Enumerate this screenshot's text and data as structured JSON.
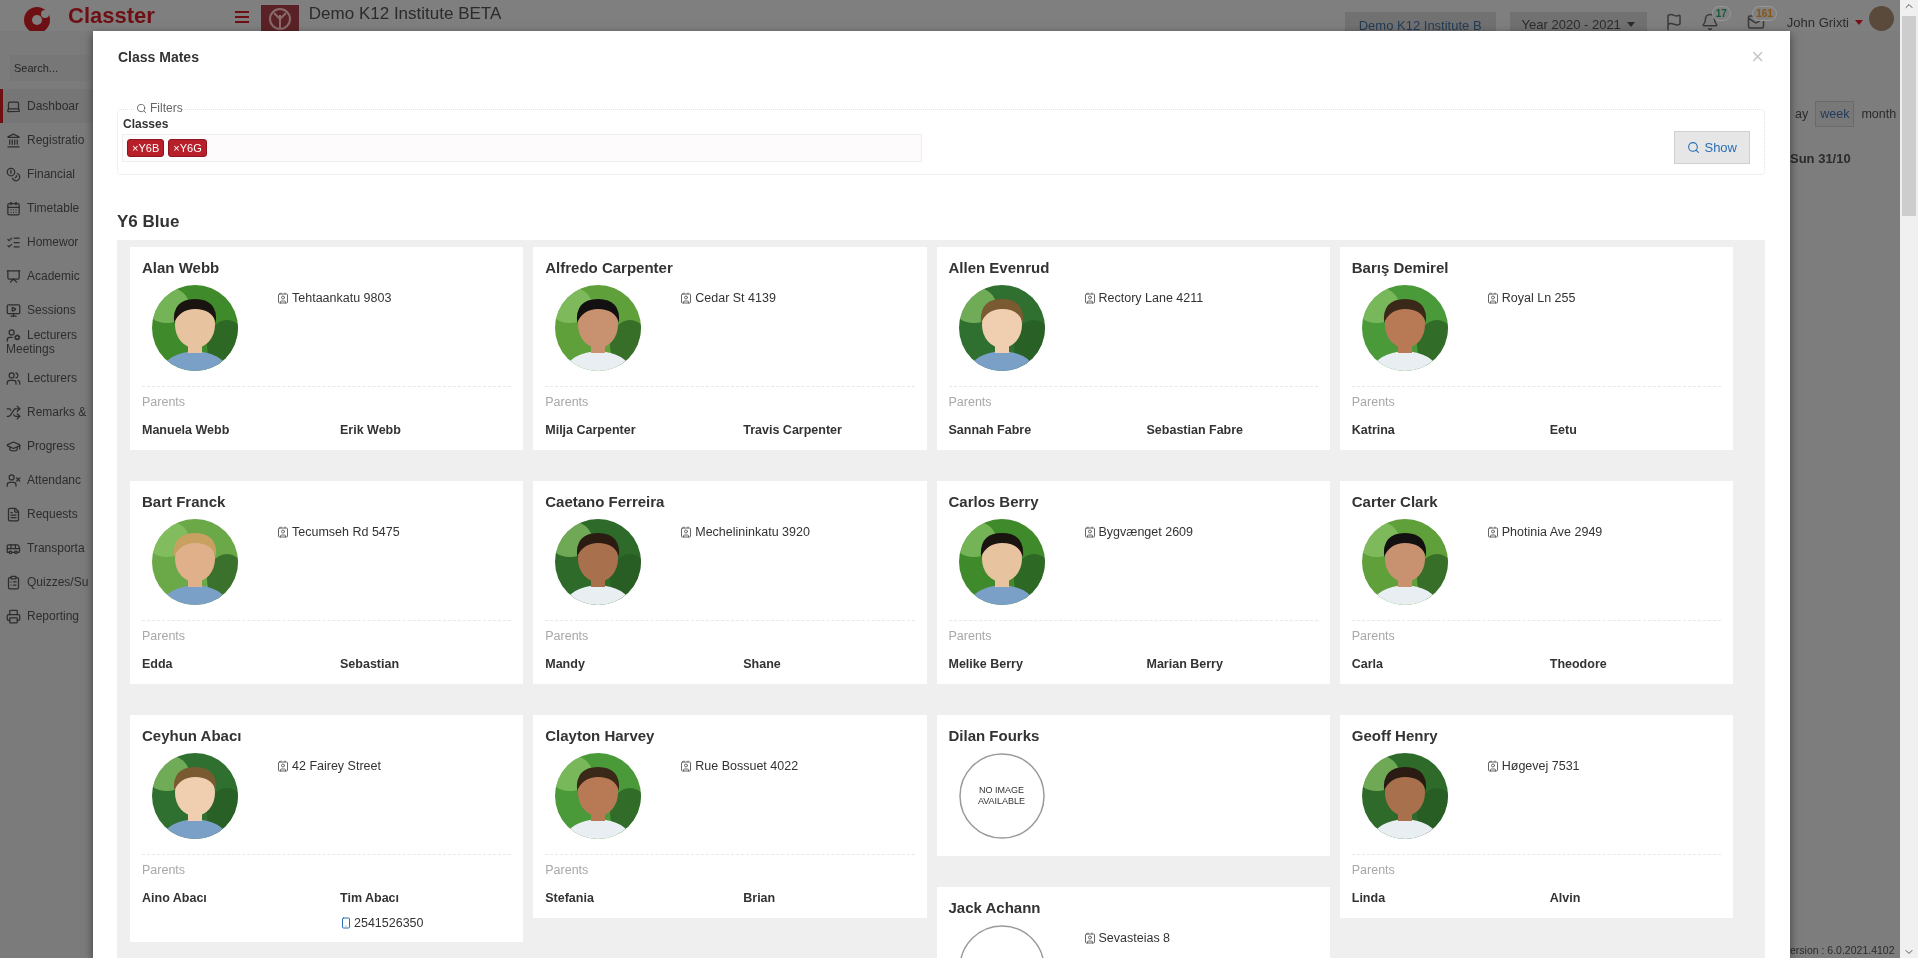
{
  "header": {
    "brand": "Classter",
    "institute": "Demo K12 Institute BETA",
    "institute_button": "Demo K12 Institute B",
    "year": "Year 2020 - 2021",
    "notifications": "17",
    "messages": "161",
    "user": "John Grixti"
  },
  "sidebar": {
    "search_placeholder": "Search...",
    "items": [
      {
        "label": "Dashboar",
        "selected": true
      },
      {
        "label": "Registratio",
        "selected": false
      },
      {
        "label": "Financial",
        "selected": false
      },
      {
        "label": "Timetable",
        "selected": false
      },
      {
        "label": "Homewor",
        "selected": false
      },
      {
        "label": "Academic",
        "selected": false
      },
      {
        "label": "Sessions",
        "selected": false
      },
      {
        "label": "Lecturers",
        "continuation": "Meetings",
        "selected": false
      },
      {
        "label": "Lecturers",
        "selected": false
      },
      {
        "label": "Remarks &",
        "selected": false
      },
      {
        "label": "Progress",
        "selected": false
      },
      {
        "label": "Attendanc",
        "selected": false
      },
      {
        "label": "Requests",
        "selected": false
      },
      {
        "label": "Transporta",
        "selected": false
      },
      {
        "label": "Quizzes/Su",
        "selected": false
      },
      {
        "label": "Reporting",
        "selected": false
      }
    ]
  },
  "calendar": {
    "views": [
      {
        "label": "ay",
        "selected": false
      },
      {
        "label": "week",
        "selected": true
      },
      {
        "label": "month",
        "selected": false
      }
    ],
    "day_header": "Sun 31/10"
  },
  "version": "ersion : 6.0.2021.4102",
  "modal": {
    "title": "Class Mates",
    "close": "×",
    "filters": {
      "legend": "Filters",
      "label": "Classes",
      "tags": [
        {
          "remove": "×",
          "label": "Y6B"
        },
        {
          "remove": "×",
          "label": "Y6G"
        }
      ],
      "show": "Show"
    },
    "group": {
      "title": "Y6 Blue",
      "students": [
        {
          "name": "Alan Webb",
          "photo": {
            "kind": "picture"
          },
          "address": "Tehtaankatu 9803",
          "parents_label": "Parents",
          "parents": [
            {
              "name": "Manuela Webb"
            },
            {
              "name": "Erik Webb"
            }
          ]
        },
        {
          "name": "Alfredo Carpenter",
          "photo": {
            "kind": "picture"
          },
          "address": "Cedar St 4139",
          "parents_label": "Parents",
          "parents": [
            {
              "name": "Milja Carpenter"
            },
            {
              "name": "Travis Carpenter"
            }
          ]
        },
        {
          "name": "Allen Evenrud",
          "photo": {
            "kind": "picture"
          },
          "address": "Rectory Lane 4211",
          "parents_label": "Parents",
          "parents": [
            {
              "name": "Sannah Fabre"
            },
            {
              "name": "Sebastian Fabre"
            }
          ]
        },
        {
          "name": "Barış Demirel",
          "photo": {
            "kind": "picture"
          },
          "address": "Royal Ln 255",
          "parents_label": "Parents",
          "parents": [
            {
              "name": "Katrina"
            },
            {
              "name": "Eetu"
            }
          ]
        },
        {
          "name": "Bart Franck",
          "photo": {
            "kind": "picture"
          },
          "address": "Tecumseh Rd 5475",
          "parents_label": "Parents",
          "parents": [
            {
              "name": "Edda"
            },
            {
              "name": "Sebastian"
            }
          ]
        },
        {
          "name": "Caetano Ferreira",
          "photo": {
            "kind": "picture"
          },
          "address": "Mechelininkatu 3920",
          "parents_label": "Parents",
          "parents": [
            {
              "name": "Mandy"
            },
            {
              "name": "Shane"
            }
          ]
        },
        {
          "name": "Carlos Berry",
          "photo": {
            "kind": "picture"
          },
          "address": "Bygvænget 2609",
          "parents_label": "Parents",
          "parents": [
            {
              "name": "Melike Berry"
            },
            {
              "name": "Marian Berry"
            }
          ]
        },
        {
          "name": "Carter Clark",
          "photo": {
            "kind": "picture"
          },
          "address": "Photinia Ave 2949",
          "parents_label": "Parents",
          "parents": [
            {
              "name": "Carla"
            },
            {
              "name": "Theodore"
            }
          ]
        },
        {
          "name": "Ceyhun Abacı",
          "photo": {
            "kind": "picture"
          },
          "address": "42 Fairey Street",
          "parents_label": "Parents",
          "parents": [
            {
              "name": "Aino Abacı"
            },
            {
              "name": "Tim Abacı",
              "phone": "2541526350"
            }
          ]
        },
        {
          "name": "Clayton Harvey",
          "photo": {
            "kind": "picture"
          },
          "address": "Rue Bossuet 4022",
          "parents_label": "Parents",
          "parents": [
            {
              "name": "Stefania"
            },
            {
              "name": "Brian"
            }
          ]
        },
        {
          "name": "Dilan Fourks",
          "photo": {
            "kind": "no_image",
            "text": "NO IMAGE AVAILABLE"
          }
        },
        {
          "name": "Geoff Henry",
          "photo": {
            "kind": "picture"
          },
          "address": "Høgevej 7531",
          "parents_label": "Parents",
          "parents": [
            {
              "name": "Linda"
            },
            {
              "name": "Alvin"
            }
          ]
        },
        {
          "name": "Jack Achann",
          "photo": {
            "kind": "no_image"
          },
          "address": "Sevasteias 8"
        }
      ]
    }
  }
}
